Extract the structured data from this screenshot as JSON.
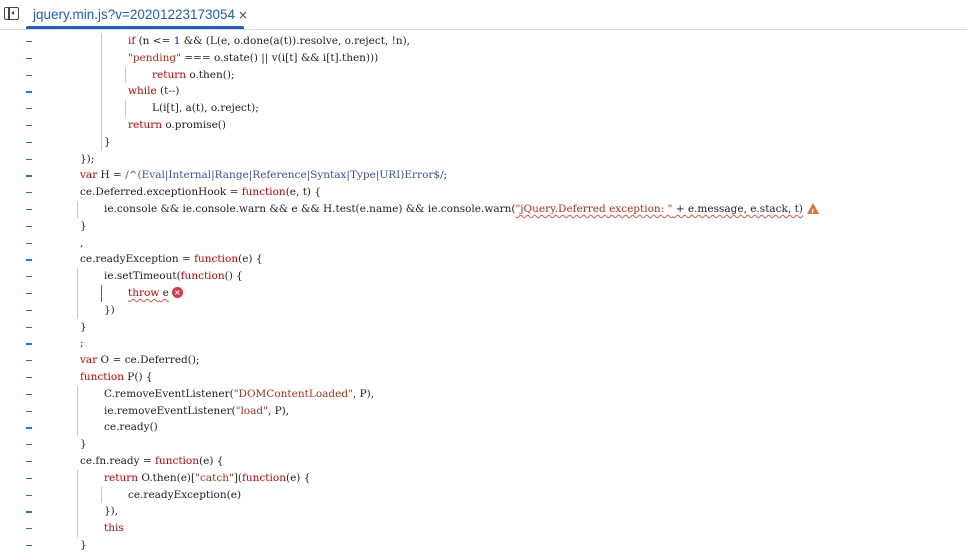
{
  "tab": {
    "title": "jquery.min.js?v=20201223173054",
    "close_glyph": "×"
  },
  "icons": {
    "nav_toggle": "sidebar-toggle-icon",
    "close": "close-icon",
    "warning": "warning-icon",
    "error": "error-icon"
  },
  "code_lines": [
    {
      "indent": 4,
      "segments": [
        [
          "kw",
          "if"
        ],
        [
          "p",
          " (n <= "
        ],
        [
          "num",
          "1"
        ],
        [
          "p",
          " && (L(e, o.done(a(t)).resolve, o.reject, !n),"
        ]
      ]
    },
    {
      "indent": 4,
      "segments": [
        [
          "str",
          "\"pending\""
        ],
        [
          "p",
          " === o.state() || v(i[t] && i[t].then)))"
        ]
      ]
    },
    {
      "indent": 5,
      "segments": [
        [
          "kw",
          "return"
        ],
        [
          "p",
          " o.then();"
        ]
      ]
    },
    {
      "indent": 4,
      "segments": [
        [
          "kw",
          "while"
        ],
        [
          "p",
          " (t--)"
        ]
      ]
    },
    {
      "indent": 5,
      "segments": [
        [
          "p",
          "L(i[t], a(t), o.reject);"
        ]
      ]
    },
    {
      "indent": 4,
      "segments": [
        [
          "kw",
          "return"
        ],
        [
          "p",
          " o.promise()"
        ]
      ]
    },
    {
      "indent": 3,
      "segments": [
        [
          "p",
          "}"
        ]
      ]
    },
    {
      "indent": 2,
      "segments": [
        [
          "p",
          "});"
        ]
      ]
    },
    {
      "indent": 2,
      "segments": [
        [
          "kw",
          "var"
        ],
        [
          "p",
          " H = "
        ],
        [
          "rx",
          "/^(Eval|Internal|Range|Reference|Syntax|Type|URI)Error$/"
        ],
        [
          "p",
          ";"
        ]
      ]
    },
    {
      "indent": 2,
      "segments": [
        [
          "p",
          "ce.Deferred.exceptionHook = "
        ],
        [
          "kw",
          "function"
        ],
        [
          "p",
          "(e, t) {"
        ]
      ]
    },
    {
      "indent": 3,
      "segments": [
        [
          "p",
          "ie.console && ie.console.warn && e && H.test(e.name) && ie.console.warn("
        ],
        [
          "sqstr",
          "\"jQuery.Deferred exception: \""
        ],
        [
          "sq",
          " + e.message, e.stack, t)"
        ],
        [
          "warn",
          ""
        ]
      ]
    },
    {
      "indent": 2,
      "segments": [
        [
          "p",
          "}"
        ]
      ]
    },
    {
      "indent": 2,
      "segments": [
        [
          "p",
          ","
        ]
      ]
    },
    {
      "indent": 2,
      "segments": [
        [
          "p",
          "ce.readyException = "
        ],
        [
          "kw",
          "function"
        ],
        [
          "p",
          "(e) {"
        ]
      ]
    },
    {
      "indent": 3,
      "segments": [
        [
          "p",
          "ie.setTimeout("
        ],
        [
          "kw",
          "function"
        ],
        [
          "p",
          "() {"
        ]
      ]
    },
    {
      "indent": 4,
      "segments": [
        [
          "sqkw",
          "throw"
        ],
        [
          "sq",
          " e"
        ],
        [
          "err",
          ""
        ]
      ]
    },
    {
      "indent": 3,
      "segments": [
        [
          "p",
          "})"
        ]
      ]
    },
    {
      "indent": 2,
      "segments": [
        [
          "p",
          "}"
        ]
      ]
    },
    {
      "indent": 2,
      "segments": [
        [
          "p",
          ";"
        ]
      ]
    },
    {
      "indent": 2,
      "segments": [
        [
          "kw",
          "var"
        ],
        [
          "p",
          " O = ce.Deferred();"
        ]
      ]
    },
    {
      "indent": 2,
      "segments": [
        [
          "kw",
          "function"
        ],
        [
          "p",
          " P() {"
        ]
      ]
    },
    {
      "indent": 3,
      "segments": [
        [
          "p",
          "C.removeEventListener("
        ],
        [
          "str",
          "\"DOMContentLoaded\""
        ],
        [
          "p",
          ", P),"
        ]
      ]
    },
    {
      "indent": 3,
      "segments": [
        [
          "p",
          "ie.removeEventListener("
        ],
        [
          "str",
          "\"load\""
        ],
        [
          "p",
          ", P),"
        ]
      ]
    },
    {
      "indent": 3,
      "segments": [
        [
          "p",
          "ce.ready()"
        ]
      ]
    },
    {
      "indent": 2,
      "segments": [
        [
          "p",
          "}"
        ]
      ]
    },
    {
      "indent": 2,
      "segments": [
        [
          "p",
          "ce.fn.ready = "
        ],
        [
          "kw",
          "function"
        ],
        [
          "p",
          "(e) {"
        ]
      ]
    },
    {
      "indent": 3,
      "segments": [
        [
          "kw",
          "return"
        ],
        [
          "p",
          " O.then(e)["
        ],
        [
          "str",
          "\"catch\""
        ],
        [
          "p",
          "]("
        ],
        [
          "kw",
          "function"
        ],
        [
          "p",
          "(e) {"
        ]
      ]
    },
    {
      "indent": 4,
      "segments": [
        [
          "p",
          "ce.readyException(e)"
        ]
      ]
    },
    {
      "indent": 3,
      "segments": [
        [
          "p",
          "}),"
        ]
      ]
    },
    {
      "indent": 3,
      "segments": [
        [
          "kw",
          "this"
        ]
      ]
    },
    {
      "indent": 2,
      "segments": [
        [
          "p",
          "}"
        ]
      ]
    }
  ]
}
